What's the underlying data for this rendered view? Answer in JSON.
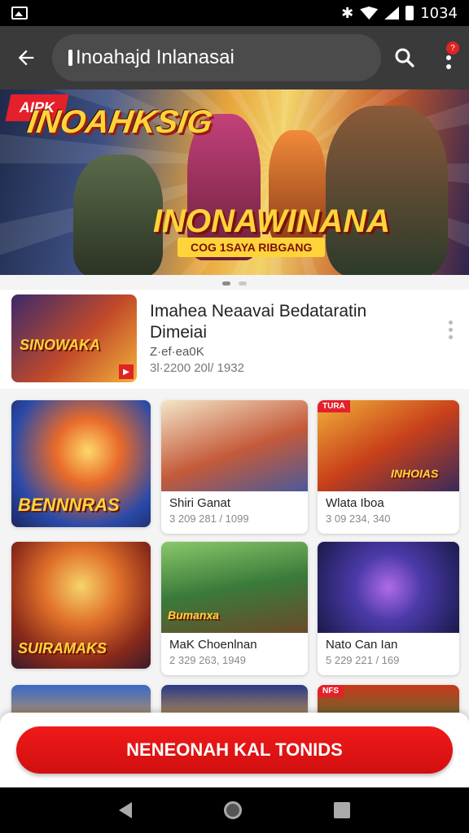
{
  "status_bar": {
    "time": "1034",
    "icons": [
      "image-icon",
      "bluetooth-icon",
      "wifi-icon",
      "signal-icon",
      "battery-icon"
    ]
  },
  "app_bar": {
    "search_text": "Inoahajd Inlanasai",
    "notification_badge": "?",
    "icons": [
      "back-arrow-icon",
      "search-icon",
      "more-vert-icon"
    ]
  },
  "hero": {
    "tag": "AIPK",
    "title": "INOAHKSIG",
    "subtitle": "INONAWINANA",
    "tagline": "COG 1SAYA RIBGANG",
    "slides": 2,
    "active_slide": 1
  },
  "featured": {
    "title": "Imahea Neaavai Bedataratin Dimeiai",
    "meta1": "Z·ef·ea0K",
    "meta2": "3l·2200 20l/ 1932",
    "thumb_label": "SINOWAKA"
  },
  "grid": [
    {
      "art_label": "BENNNRAS",
      "title": "",
      "meta": ""
    },
    {
      "art_label": "",
      "title": "Shiri Ganat",
      "meta": "3 209 281 / 1099"
    },
    {
      "art_label": "INHOIAS",
      "tag": "TURA",
      "title": "Wlata Iboa",
      "meta": "3 09 234, 340"
    },
    {
      "art_label": "SUIRAMAKS",
      "title": "",
      "meta": ""
    },
    {
      "art_label": "Bumanxa",
      "title": "MaK Choenlnan",
      "meta": "2 329 263, 1949"
    },
    {
      "art_label": "",
      "title": "Nato Can Ian",
      "meta": "5 229 221 / 169"
    },
    {
      "art_label": "",
      "title": "",
      "meta": ""
    },
    {
      "art_label": "",
      "title": "",
      "meta": ""
    },
    {
      "art_label": "",
      "tag": "NFS",
      "title": "",
      "meta": ""
    }
  ],
  "cta": {
    "label": "NENEONAH KAL TONIDS"
  },
  "colors": {
    "app_bar": "#3a3a3a",
    "cta": "#e01414",
    "title_gold": "#ffd43a"
  }
}
